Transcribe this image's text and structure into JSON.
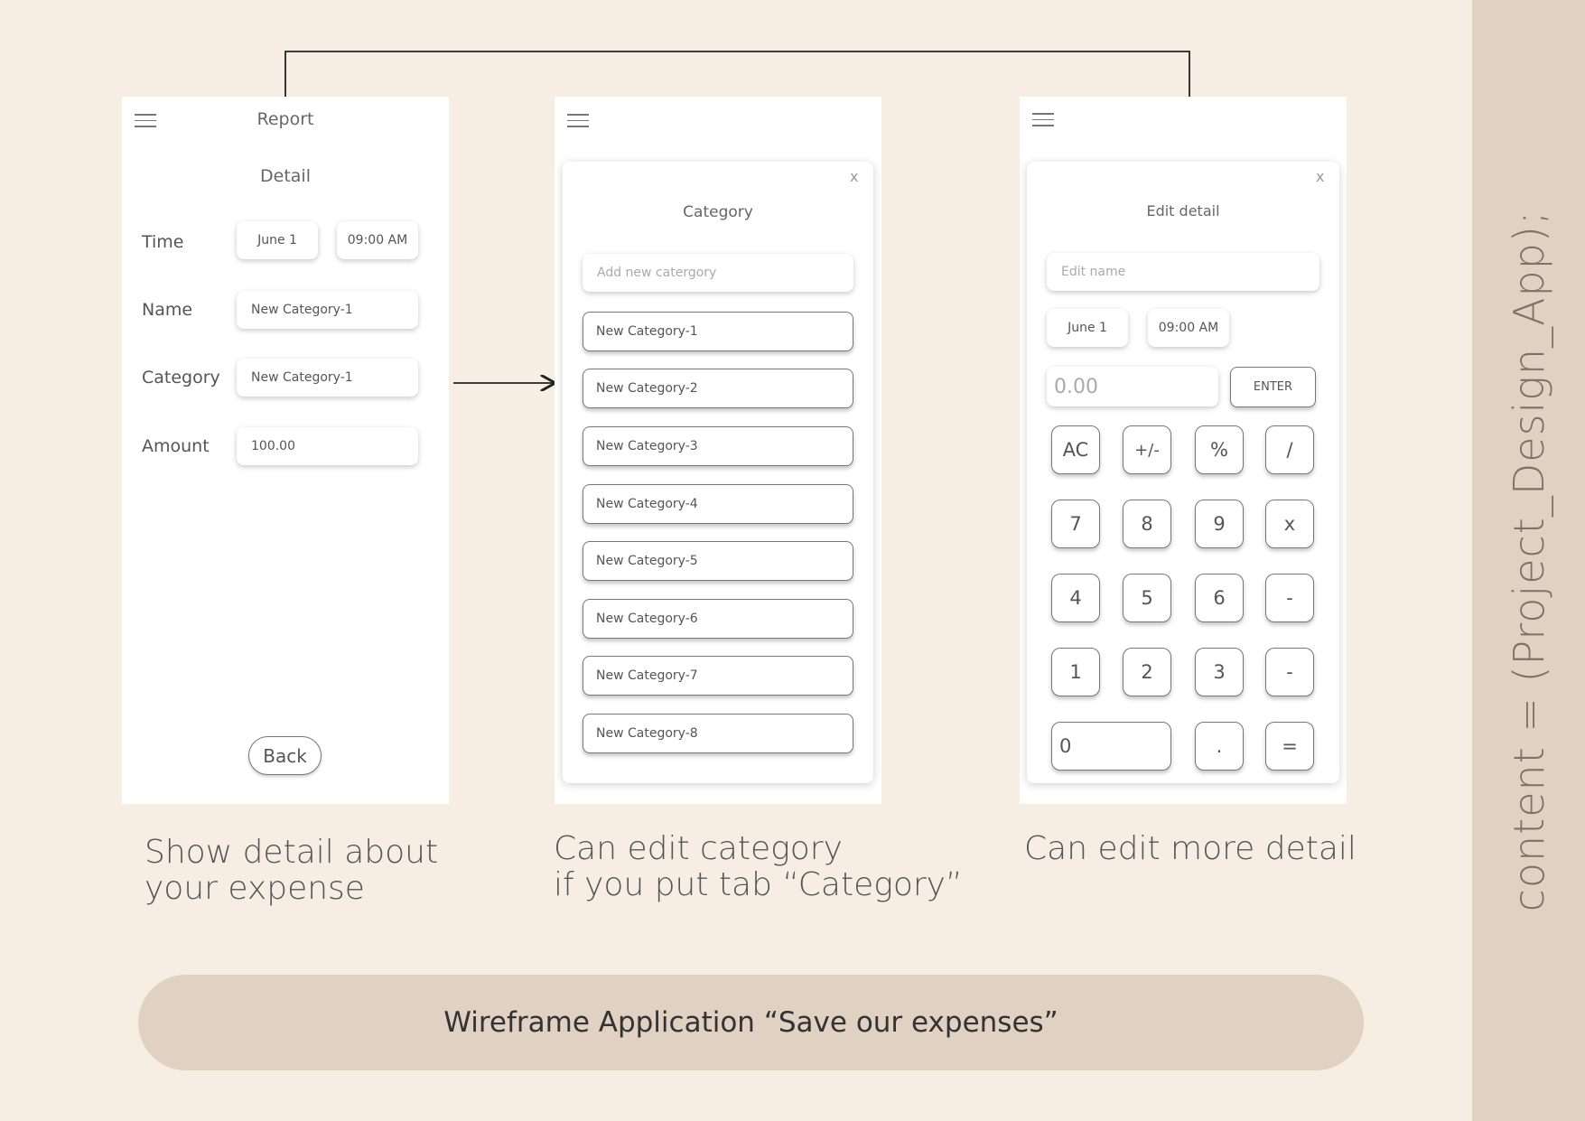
{
  "sidebar": {
    "text": "content = (Project_Design_App);"
  },
  "detail_screen": {
    "header_title": "Report",
    "title": "Detail",
    "rows": {
      "time_label": "Time",
      "date_value": "June 1",
      "time_value": "09:00 AM",
      "name_label": "Name",
      "name_value": "New Category-1",
      "category_label": "Category",
      "category_value": "New Category-1",
      "amount_label": "Amount",
      "amount_value": "100.00"
    },
    "back_label": "Back"
  },
  "category_screen": {
    "title": "Category",
    "close": "x",
    "add_placeholder": "Add new catergory",
    "items": [
      "New Category-1",
      "New Category-2",
      "New Category-3",
      "New Category-4",
      "New Category-5",
      "New Category-6",
      "New Category-7",
      "New Category-8"
    ]
  },
  "edit_screen": {
    "title": "Edit detail",
    "close": "x",
    "name_placeholder": "Edit name",
    "date_value": "June 1",
    "time_value": "09:00 AM",
    "amount_placeholder": "0.00",
    "enter_label": "ENTER",
    "keys": {
      "ac": "AC",
      "plusminus": "+/-",
      "percent": "%",
      "divide": "/",
      "k7": "7",
      "k8": "8",
      "k9": "9",
      "multiply": "x",
      "k4": "4",
      "k5": "5",
      "k6": "6",
      "minus": "-",
      "k1": "1",
      "k2": "2",
      "k3": "3",
      "plus": "-",
      "k0": "0",
      "dot": ".",
      "equals": "="
    }
  },
  "captions": {
    "detail_line1": "Show detail about",
    "detail_line2": "your expense",
    "category_line1": "Can edit category",
    "category_line2": "if you put tab “Category”",
    "edit_line1": "Can edit more detail"
  },
  "banner": "Wireframe Application “Save our expenses”"
}
